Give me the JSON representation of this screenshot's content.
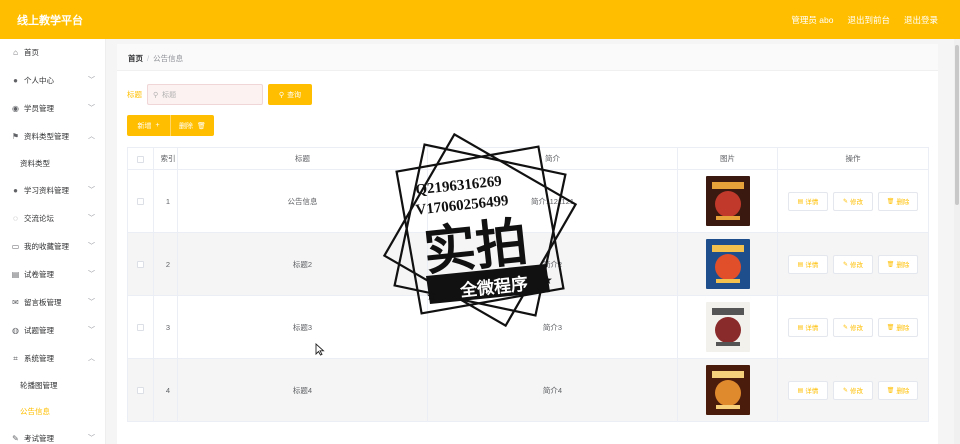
{
  "app": {
    "title": "线上教学平台"
  },
  "header": {
    "user": "管理员 abo",
    "back": "退出到前台",
    "logout": "退出登录"
  },
  "sidebar": {
    "items": [
      {
        "label": "首页",
        "icon": "home-icon",
        "glyph": "⌂",
        "chevron": false
      },
      {
        "label": "个人中心",
        "icon": "user-icon",
        "glyph": "●",
        "chevron": true
      },
      {
        "label": "学员管理",
        "icon": "location-icon",
        "glyph": "◉",
        "chevron": true
      },
      {
        "label": "资料类型管理",
        "icon": "flag-icon",
        "glyph": "⚑",
        "chevron": true,
        "open": true
      },
      {
        "label": "资料类型",
        "sub": true
      },
      {
        "label": "学习资料管理",
        "icon": "user-icon",
        "glyph": "●",
        "chevron": true
      },
      {
        "label": "交流论坛",
        "icon": "chat-icon",
        "glyph": "◌",
        "chevron": true
      },
      {
        "label": "我的收藏管理",
        "icon": "wallet-icon",
        "glyph": "▭",
        "chevron": true
      },
      {
        "label": "试卷管理",
        "icon": "chart-icon",
        "glyph": "▤",
        "chevron": true
      },
      {
        "label": "留言板管理",
        "icon": "mail-icon",
        "glyph": "✉",
        "chevron": true
      },
      {
        "label": "试题管理",
        "icon": "globe-icon",
        "glyph": "◍",
        "chevron": true
      },
      {
        "label": "系统管理",
        "icon": "crop-icon",
        "glyph": "⌗",
        "chevron": true,
        "open": true
      },
      {
        "label": "轮播图管理",
        "sub": true
      },
      {
        "label": "公告信息",
        "sub": true,
        "active": true
      },
      {
        "label": "考试管理",
        "icon": "edit-icon",
        "glyph": "✎",
        "chevron": true
      }
    ]
  },
  "breadcrumb": {
    "home": "首页",
    "current": "公告信息"
  },
  "search": {
    "label": "标题",
    "placeholder": "标题",
    "query": "查询"
  },
  "actions": {
    "add": "新增",
    "delete": "删除"
  },
  "table": {
    "headers": {
      "index": "索引",
      "title": "标题",
      "intro": "简介",
      "image": "图片",
      "ops": "操作"
    },
    "rows": [
      {
        "index": "1",
        "title": "公告信息",
        "intro": "简介1121121",
        "palette": [
          "#3a1a10",
          "#c0392b",
          "#e8a23a"
        ]
      },
      {
        "index": "2",
        "title": "标题2",
        "intro": "简介2",
        "palette": [
          "#1e4f8c",
          "#e04e2a",
          "#f2c14e"
        ]
      },
      {
        "index": "3",
        "title": "标题3",
        "intro": "简介3",
        "palette": [
          "#f3f1ec",
          "#8a2b2b",
          "#555555"
        ]
      },
      {
        "index": "4",
        "title": "标题4",
        "intro": "简介4",
        "palette": [
          "#4a1c0c",
          "#e08a2e",
          "#f6d07a"
        ]
      }
    ],
    "ops": {
      "detail": "详情",
      "edit": "修改",
      "delete": "删除"
    }
  },
  "watermark": {
    "qq": "Q2196316269",
    "vx": "V17060256499",
    "big": "实拍",
    "banner": "全微程序"
  }
}
